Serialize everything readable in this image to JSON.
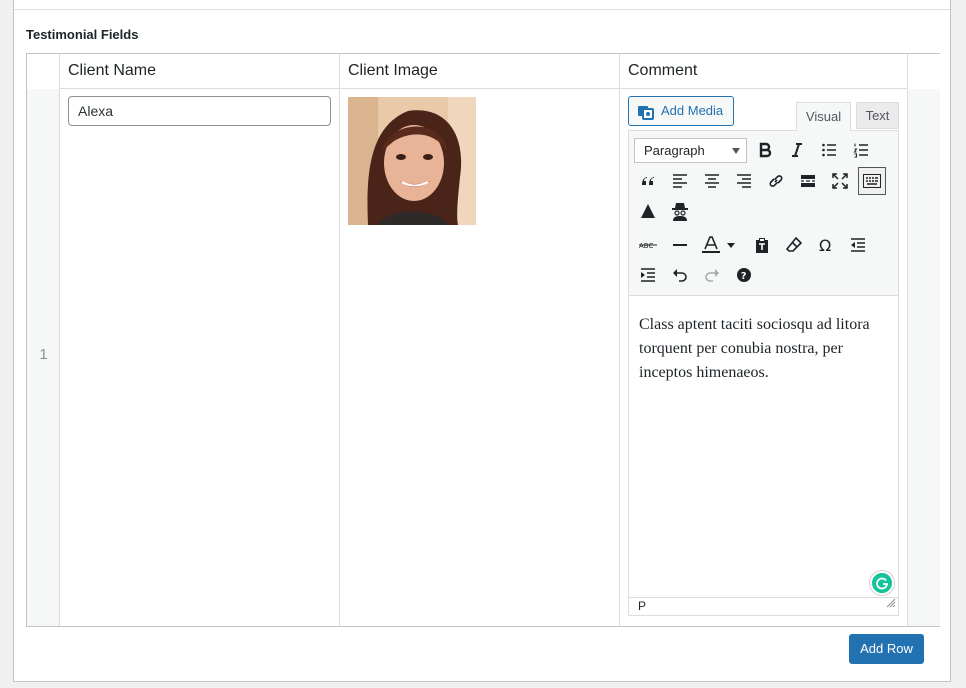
{
  "section": {
    "title": "Testimonial Fields"
  },
  "table": {
    "headers": [
      "Client Name",
      "Client Image",
      "Comment"
    ],
    "rows": [
      {
        "order": "1",
        "client_name": "Alexa",
        "comment": {
          "add_media_label": "Add Media",
          "tab_visual": "Visual",
          "tab_text": "Text",
          "format_select": "Paragraph",
          "body": "Class aptent taciti sociosqu ad litora torquent per conubia nostra, per inceptos himenaeos.",
          "status_path": "P"
        }
      }
    ],
    "add_row_label": "Add Row"
  },
  "toolbar_icons": [
    "bold-icon",
    "italic-icon",
    "bullet-list-icon",
    "numbered-list-icon",
    "blockquote-icon",
    "align-left-icon",
    "align-center-icon",
    "align-right-icon",
    "link-icon",
    "read-more-icon",
    "fullscreen-icon",
    "toolbar-toggle-icon",
    "triangle-icon",
    "spy-icon",
    "strikethrough-icon",
    "horizontal-line-icon",
    "text-color-icon",
    "paste-text-icon",
    "clear-formatting-icon",
    "special-character-icon",
    "outdent-icon",
    "indent-icon",
    "undo-icon",
    "redo-icon",
    "help-icon"
  ],
  "colors": {
    "primary": "#2271b1",
    "grammarly": "#15c39a",
    "border": "#c3c4c7"
  }
}
